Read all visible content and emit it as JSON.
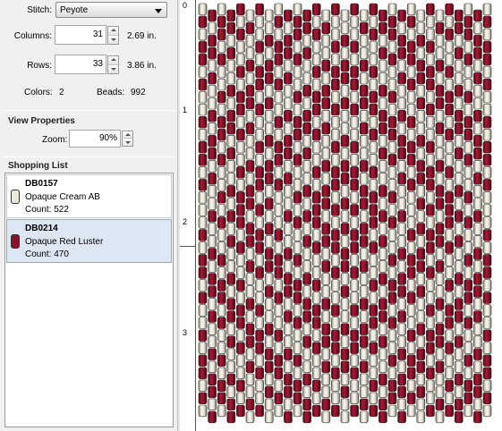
{
  "stitch": {
    "label": "Stitch:",
    "value": "Peyote"
  },
  "columns": {
    "label": "Columns:",
    "value": "31",
    "size": "2.69 in."
  },
  "rows": {
    "label": "Rows:",
    "value": "33",
    "size": "3.86 in."
  },
  "stats": {
    "colors_label": "Colors:",
    "colors_value": "2",
    "beads_label": "Beads:",
    "beads_value": "992"
  },
  "view": {
    "header": "View Properties",
    "zoom_label": "Zoom:",
    "zoom_value": "90%"
  },
  "shopping": {
    "header": "Shopping List",
    "items": [
      {
        "code": "DB0157",
        "name": "Opaque Cream AB",
        "count": "Count: 522",
        "color": "#ebe8dc",
        "selected": false
      },
      {
        "code": "DB0214",
        "name": "Opaque Red Luster",
        "count": "Count: 470",
        "color": "#8a1228",
        "selected": true
      }
    ]
  },
  "ruler": {
    "ticks": [
      "0",
      "1",
      "2",
      "3"
    ]
  },
  "pattern": {
    "columns": 31,
    "rows": 33,
    "colors": {
      "cream": "#ebe8dc",
      "red": "#8a1228"
    },
    "layout": "peyote diamond pattern"
  }
}
